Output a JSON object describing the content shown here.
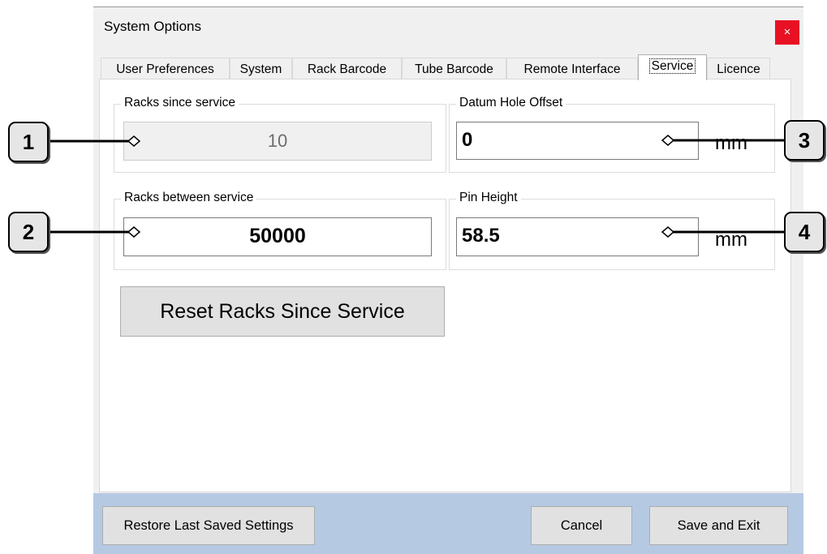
{
  "window": {
    "title": "System Options",
    "close_symbol": "×"
  },
  "tabs": [
    {
      "label": "User Preferences",
      "active": false
    },
    {
      "label": "System",
      "active": false
    },
    {
      "label": "Rack Barcode",
      "active": false
    },
    {
      "label": "Tube Barcode",
      "active": false
    },
    {
      "label": "Remote Interface",
      "active": false
    },
    {
      "label": "Service",
      "active": true
    },
    {
      "label": "Licence",
      "active": false
    }
  ],
  "service": {
    "racks_since_service": {
      "label": "Racks since service",
      "value": "10"
    },
    "racks_between_service": {
      "label": "Racks between service",
      "value": "50000"
    },
    "datum_hole_offset": {
      "label": "Datum Hole Offset",
      "value": "0",
      "unit": "mm"
    },
    "pin_height": {
      "label": "Pin Height",
      "value": "58.5",
      "unit": "mm"
    },
    "reset_button": "Reset Racks Since Service"
  },
  "footer": {
    "restore_button": "Restore Last Saved Settings",
    "cancel_button": "Cancel",
    "save_button": "Save and Exit"
  },
  "callouts": [
    "1",
    "2",
    "3",
    "4"
  ],
  "colors": {
    "close_bg": "#e81123",
    "footer_bg": "#b5c9e3",
    "window_bg": "#f0f0f0"
  }
}
